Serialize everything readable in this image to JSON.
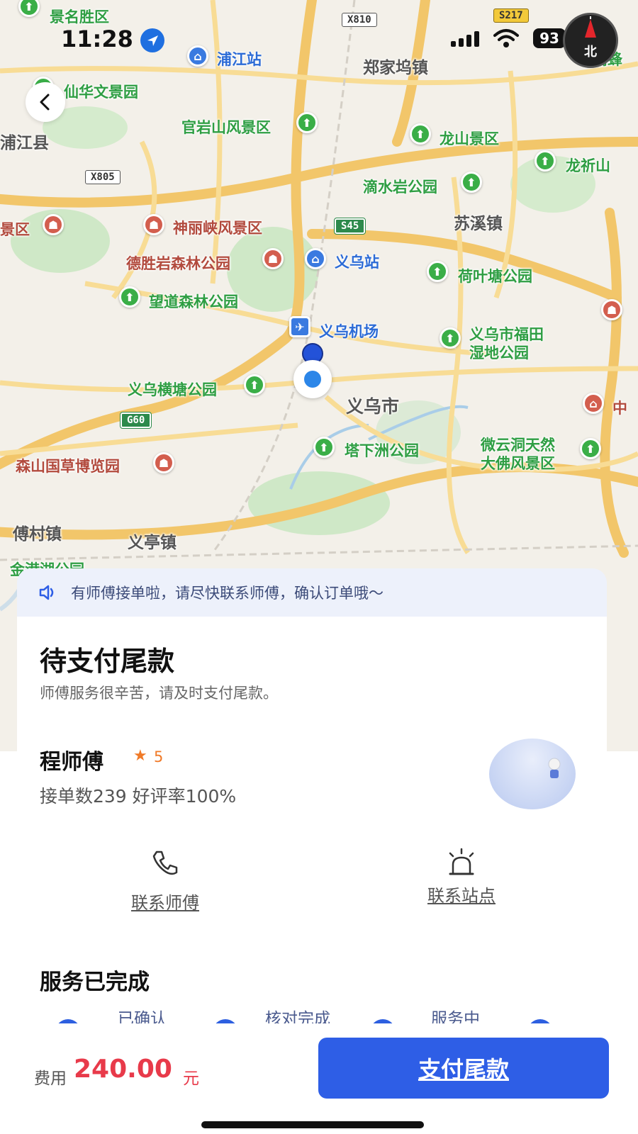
{
  "status_bar": {
    "time": "11:28",
    "battery": "93"
  },
  "map": {
    "compass_label": "北",
    "labels": {
      "top_scenic": "景名胜区",
      "pujiang_station": "浦江站",
      "zhengjiawu": "郑家坞镇",
      "xianhua": "仙华文景园",
      "guanyanshan": "官岩山风景区",
      "longshan": "龙山景区",
      "longqishan": "龙祈山",
      "pujiang_county": "浦江县",
      "dishuiyan": "滴水岩公园",
      "suxi": "苏溪镇",
      "left_scenic": "景区",
      "shenlixia": "神丽峡风景区",
      "deshengyan": "德胜岩森林公园",
      "yiwu_station": "义乌站",
      "heyetang": "荷叶塘公园",
      "wangdao": "望道森林公园",
      "yiwu_airport": "义乌机场",
      "futian": "义乌市福田",
      "futian2": "湿地公园",
      "hengtang": "义乌横塘公园",
      "yiwu_city": "义乌市",
      "right_edge": "中",
      "senshan": "森山国草博览园",
      "taxiazhou": "塔下洲公园",
      "weiyundong": "微云洞天然",
      "weiyundong2": "大佛风景区",
      "fucun": "傅村镇",
      "yiting": "义亭镇",
      "jingang": "金港湖公园",
      "right_top": "蜻蜂"
    },
    "shields": {
      "x810": "X810",
      "s217": "S217",
      "x805": "X805",
      "s45": "S45",
      "g60": "G60"
    }
  },
  "notice": {
    "text": "有师傅接单啦，请尽快联系师傅，确认订单哦～"
  },
  "order": {
    "title": "待支付尾款",
    "subtitle": "师傅服务很辛苦，请及时支付尾款。"
  },
  "driver": {
    "name": "程师傅",
    "rating": "5",
    "stats": "接单数239 好评率100%"
  },
  "actions": {
    "contact_driver": "联系师傅",
    "contact_station": "联系站点"
  },
  "progress": {
    "title": "服务已完成",
    "steps": [
      "已确认",
      "核对完成",
      "服务中"
    ]
  },
  "bottom": {
    "fee_label": "费用",
    "fee_amount": "240.00",
    "fee_unit": "元",
    "pay_label": "支付尾款"
  },
  "colors": {
    "accent": "#2e5ee6",
    "price": "#e83a4a",
    "notice_bg": "#edf1fb"
  }
}
